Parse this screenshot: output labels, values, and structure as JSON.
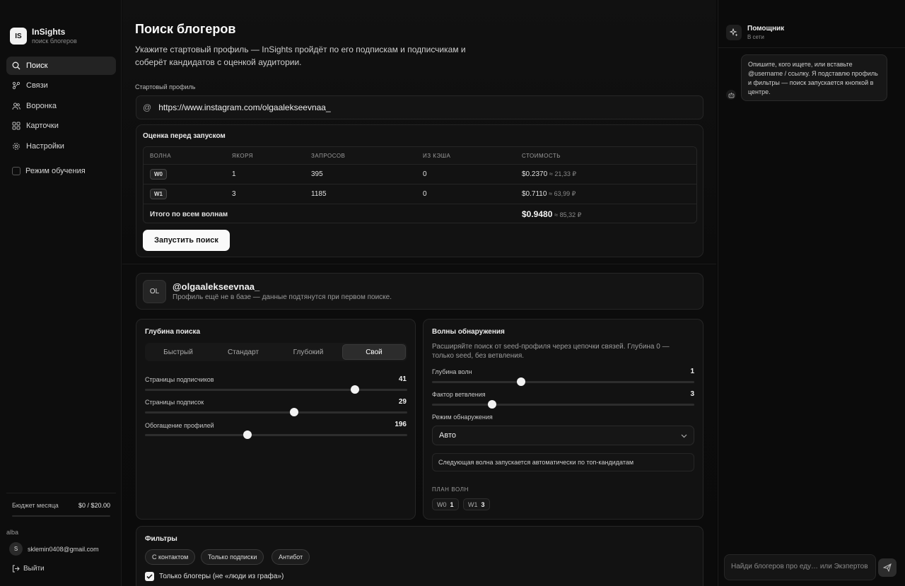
{
  "app": {
    "logo": "IS",
    "title": "InSights",
    "subtitle": "поиск блогеров"
  },
  "sidebar": {
    "items": [
      {
        "label": "Поиск",
        "icon": "search-icon",
        "active": true
      },
      {
        "label": "Связи",
        "icon": "connections-icon"
      },
      {
        "label": "Воронка",
        "icon": "users-icon"
      },
      {
        "label": "Карточки",
        "icon": "grid-icon"
      },
      {
        "label": "Настройки",
        "icon": "gear-icon"
      }
    ],
    "learning_mode": "Режим обучения",
    "budget": {
      "label": "Бюджет месяца",
      "value": "$0 / $20.00",
      "progress": 0
    },
    "user": {
      "name": "alba",
      "initial": "S",
      "email": "sklemin0408@gmail.com"
    },
    "logout": "Выйти"
  },
  "main": {
    "title": "Поиск блогеров",
    "description": "Укажите стартовый профиль — InSights пройдёт по его подпискам и подписчикам и соберёт кандидатов с оценкой аудитории.",
    "start_profile_label": "Стартовый профиль",
    "start_profile_value": "https://www.instagram.com/olgaalekseevnaa_",
    "estimate": {
      "title": "Оценка перед запуском",
      "headers": [
        "ВОЛНА",
        "ЯКОРЯ",
        "ЗАПРОСОВ",
        "ИЗ КЭША",
        "СТОИМОСТЬ"
      ],
      "rows": [
        {
          "wave": "W0",
          "anchors": "1",
          "requests": "395",
          "cache": "0",
          "cost": "$0.2370",
          "rub": "≈ 21,33 ₽"
        },
        {
          "wave": "W1",
          "anchors": "3",
          "requests": "1185",
          "cache": "0",
          "cost": "$0.7110",
          "rub": "≈ 63,99 ₽"
        }
      ],
      "total_label": "Итого по всем волнам",
      "total_cost": "$0.9480",
      "total_rub": "≈ 85,32 ₽",
      "run_button": "Запустить поиск"
    },
    "profile": {
      "initials": "OL",
      "handle": "@olgaalekseevnaa_",
      "note": "Профиль ещё не в базе — данные подтянутся при первом поиске."
    },
    "depth": {
      "title": "Глубина поиска",
      "modes": [
        "Быстрый",
        "Стандарт",
        "Глубокий",
        "Свой"
      ],
      "active_mode": "Свой",
      "sliders": [
        {
          "label": "Страницы подписчиков",
          "value": "41",
          "fraction": 0.8
        },
        {
          "label": "Страницы подписок",
          "value": "29",
          "fraction": 0.57
        },
        {
          "label": "Обогащение профилей",
          "value": "196",
          "fraction": 0.39
        }
      ]
    },
    "waves": {
      "title": "Волны обнаружения",
      "description": "Расширяйте поиск от seed-профиля через цепочки связей. Глубина 0 — только seed, без ветвления.",
      "sliders": [
        {
          "label": "Глубина волн",
          "value": "1",
          "fraction": 0.34
        },
        {
          "label": "Фактор ветвления",
          "value": "3",
          "fraction": 0.23
        }
      ],
      "mode_label": "Режим обнаружения",
      "mode_value": "Авто",
      "info": "Следующая волна запускается автоматически по топ-кандидатам",
      "plan_label": "ПЛАН ВОЛН",
      "plan": [
        {
          "wave": "W0",
          "count": "1"
        },
        {
          "wave": "W1",
          "count": "3"
        }
      ]
    },
    "filters": {
      "title": "Фильтры",
      "chips": [
        "С контактом",
        "Только подписки",
        "Антибот"
      ],
      "checkbox_label": "Только блогеры (не «люди из графа»)"
    }
  },
  "assistant": {
    "title": "Помощник",
    "status": "В сети",
    "message": "Опишите, кого ищете, или вставьте @username / ссылку. Я подставлю профиль и фильтры — поиск запускается кнопкой в центре.",
    "input_placeholder": "Найди блогеров про еду… или Экзпертов"
  }
}
